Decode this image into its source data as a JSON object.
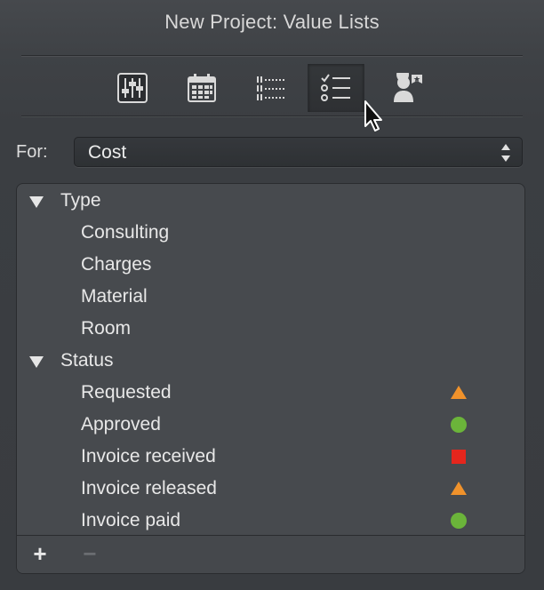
{
  "window": {
    "title": "New Project: Value Lists"
  },
  "toolbar": {
    "tabs": [
      {
        "icon": "sliders-icon",
        "selected": false
      },
      {
        "icon": "calendar-icon",
        "selected": false
      },
      {
        "icon": "dotted-list-icon",
        "selected": false
      },
      {
        "icon": "checklist-icon",
        "selected": true
      },
      {
        "icon": "user-star-icon",
        "selected": false
      }
    ]
  },
  "for_field": {
    "label": "For:",
    "value": "Cost"
  },
  "value_list": {
    "groups": [
      {
        "label": "Type",
        "expanded": true,
        "items": [
          {
            "label": "Consulting"
          },
          {
            "label": "Charges"
          },
          {
            "label": "Material"
          },
          {
            "label": "Room"
          }
        ]
      },
      {
        "label": "Status",
        "expanded": true,
        "items": [
          {
            "label": "Requested",
            "marker": "triangle",
            "color": "#f0922b"
          },
          {
            "label": "Approved",
            "marker": "circle",
            "color": "#6bb43a"
          },
          {
            "label": "Invoice received",
            "marker": "square",
            "color": "#e5261d"
          },
          {
            "label": "Invoice released",
            "marker": "triangle",
            "color": "#f0922b"
          },
          {
            "label": "Invoice paid",
            "marker": "circle",
            "color": "#6bb43a"
          }
        ]
      }
    ]
  },
  "footer": {
    "add_label": "+",
    "remove_label": "−"
  }
}
